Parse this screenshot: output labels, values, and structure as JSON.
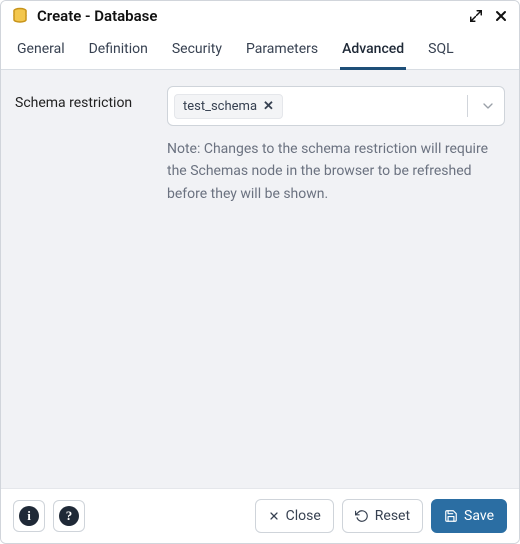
{
  "title": "Create - Database",
  "tabs": [
    {
      "label": "General"
    },
    {
      "label": "Definition"
    },
    {
      "label": "Security"
    },
    {
      "label": "Parameters"
    },
    {
      "label": "Advanced"
    },
    {
      "label": "SQL"
    }
  ],
  "activeTabIndex": 4,
  "form": {
    "schema_restriction": {
      "label": "Schema restriction",
      "chips": [
        "test_schema"
      ],
      "note": "Note: Changes to the schema restriction will require the Schemas node in the browser to be refreshed before they will be shown."
    }
  },
  "footer": {
    "close": "Close",
    "reset": "Reset",
    "save": "Save"
  },
  "colors": {
    "primary": "#2b6ea3",
    "tabActiveBorder": "#1e4f78",
    "panelBg": "#f1f2f5"
  }
}
